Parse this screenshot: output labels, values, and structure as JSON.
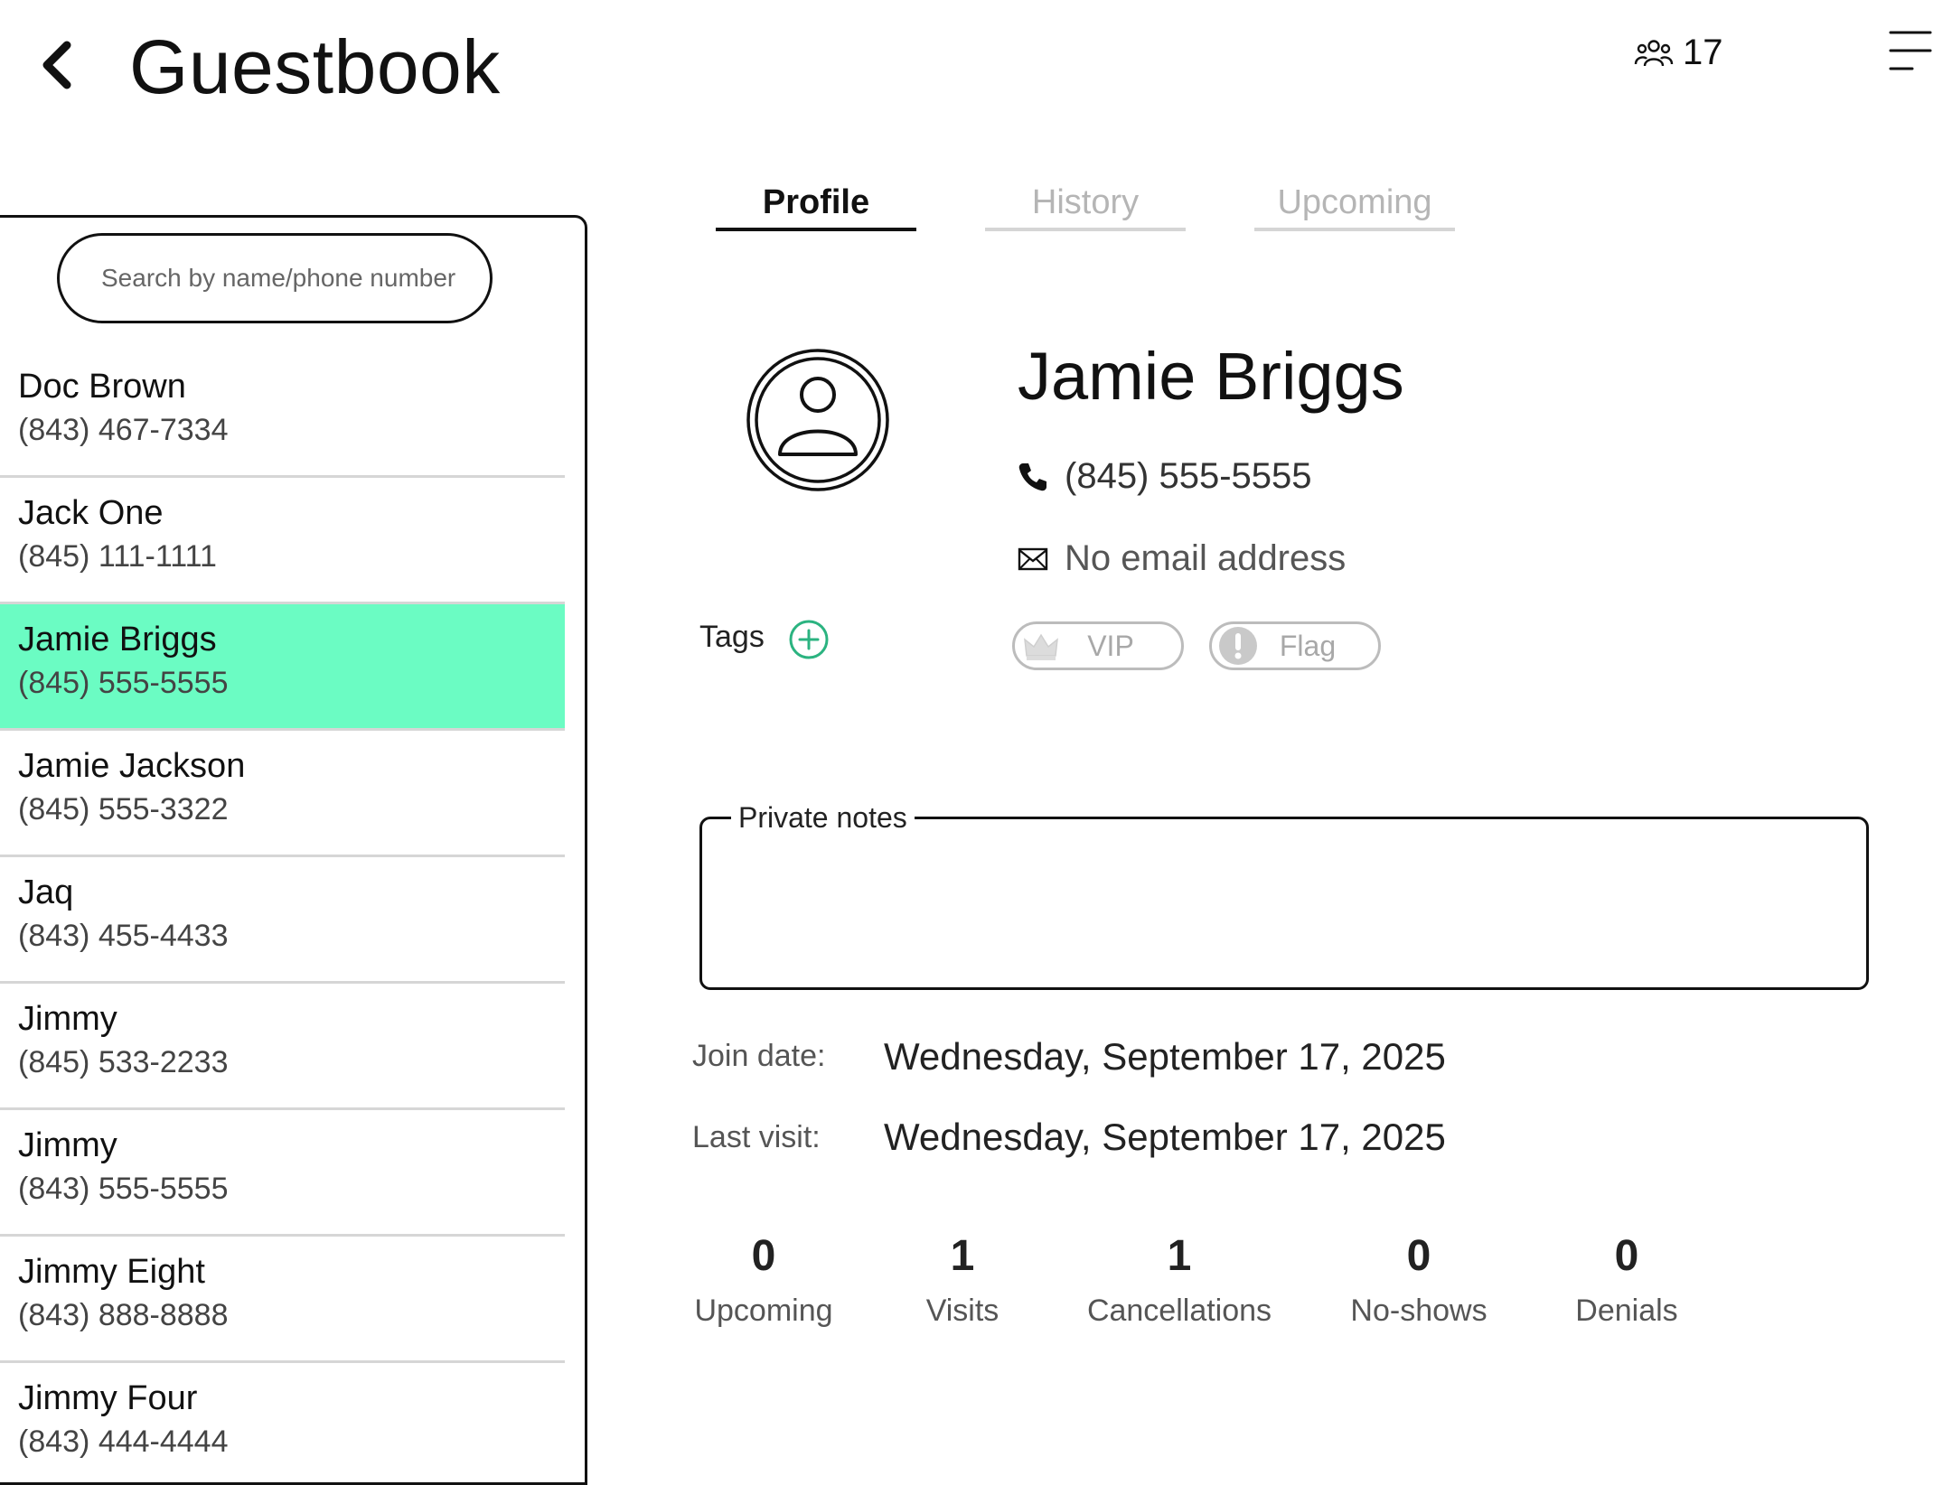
{
  "header": {
    "title": "Guestbook",
    "guest_count": "17"
  },
  "search": {
    "placeholder": "Search by name/phone number",
    "value": ""
  },
  "guests": [
    {
      "name": "Doc Brown",
      "phone": "(843) 467-7334",
      "selected": false
    },
    {
      "name": "Jack One",
      "phone": "(845) 111-1111",
      "selected": false
    },
    {
      "name": "Jamie Briggs",
      "phone": "(845) 555-5555",
      "selected": true
    },
    {
      "name": "Jamie Jackson",
      "phone": "(845) 555-3322",
      "selected": false
    },
    {
      "name": "Jaq",
      "phone": "(843) 455-4433",
      "selected": false
    },
    {
      "name": "Jimmy",
      "phone": "(845) 533-2233",
      "selected": false
    },
    {
      "name": "Jimmy",
      "phone": "(843) 555-5555",
      "selected": false
    },
    {
      "name": "Jimmy Eight",
      "phone": "(843) 888-8888",
      "selected": false
    },
    {
      "name": "Jimmy Four",
      "phone": "(843) 444-4444",
      "selected": false
    }
  ],
  "tabs": [
    {
      "label": "Profile",
      "active": true
    },
    {
      "label": "History",
      "active": false
    },
    {
      "label": "Upcoming",
      "active": false
    }
  ],
  "profile": {
    "name": "Jamie Briggs",
    "phone": "(845) 555-5555",
    "email": "No email address",
    "tags_label": "Tags",
    "tags": [
      {
        "label": "VIP",
        "icon": "crown-icon"
      },
      {
        "label": "Flag",
        "icon": "exclamation-icon"
      }
    ],
    "notes_label": "Private notes",
    "notes_value": "",
    "join_label": "Join date:",
    "join_value": "Wednesday, September 17, 2025",
    "last_visit_label": "Last visit:",
    "last_visit_value": "Wednesday, September 17, 2025"
  },
  "stats": [
    {
      "value": "0",
      "label": "Upcoming"
    },
    {
      "value": "1",
      "label": "Visits"
    },
    {
      "value": "1",
      "label": "Cancellations"
    },
    {
      "value": "0",
      "label": "No-shows"
    },
    {
      "value": "0",
      "label": "Denials"
    }
  ],
  "colors": {
    "selected_row": "#6bfcc3",
    "accent_green": "#2bb380",
    "tag_gray": "#bcbcbc"
  }
}
